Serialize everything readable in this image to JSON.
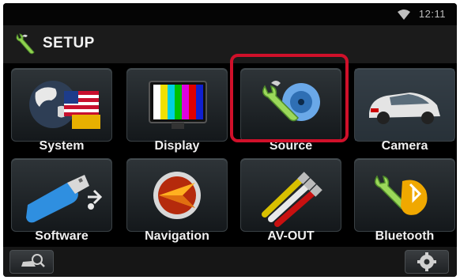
{
  "status": {
    "time": "12:11",
    "icons": [
      "wifi-icon"
    ]
  },
  "header": {
    "title": "SETUP",
    "icon": "wrench-icon"
  },
  "tiles": [
    {
      "label": "System",
      "icon": "globe-flag-icon"
    },
    {
      "label": "Display",
      "icon": "monitor-icon"
    },
    {
      "label": "Source",
      "icon": "wrench-disc-icon",
      "highlighted": true
    },
    {
      "label": "Camera",
      "icon": "car-icon"
    },
    {
      "label": "Software",
      "icon": "usb-drive-icon"
    },
    {
      "label": "Navigation",
      "icon": "compass-arrow-icon"
    },
    {
      "label": "AV-OUT",
      "icon": "av-cables-icon"
    },
    {
      "label": "Bluetooth",
      "icon": "bluetooth-wrench-icon"
    }
  ],
  "bottom": {
    "left_icon": "car-search-icon",
    "right_icon": "gear-icon"
  },
  "colors": {
    "highlight": "#d0102a",
    "background": "#000000",
    "text": "#f0f0f0"
  }
}
